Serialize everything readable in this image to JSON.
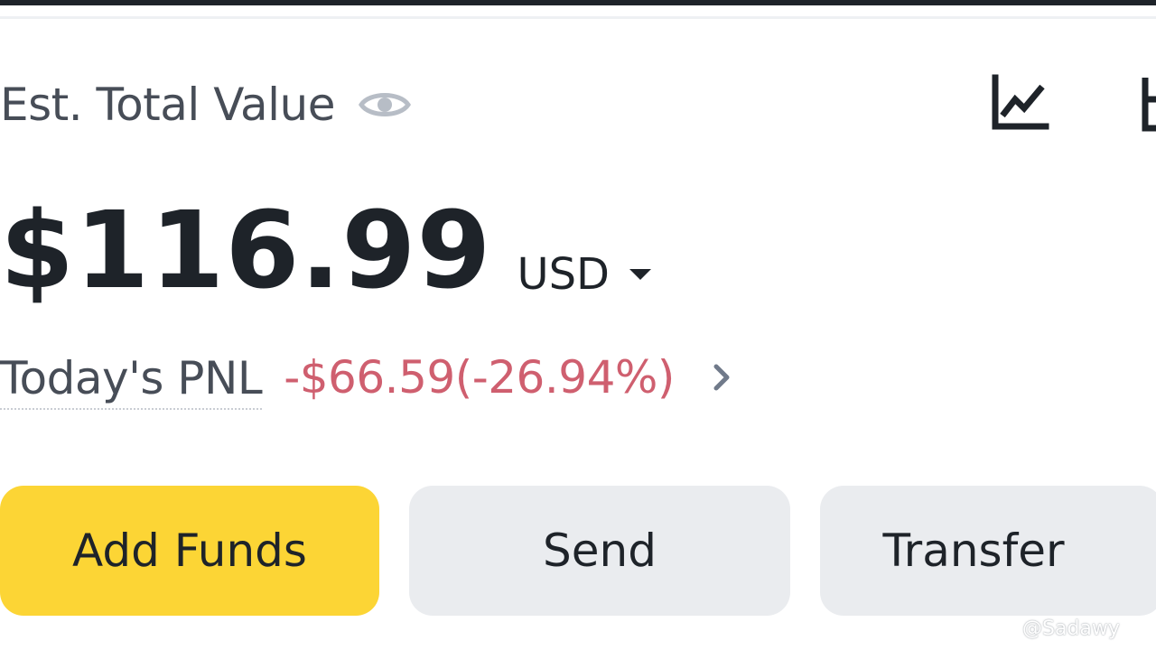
{
  "header": {
    "est_label": "Est. Total Value"
  },
  "balance": {
    "amount": "$116.99",
    "currency": "USD"
  },
  "pnl": {
    "label": "Today's PNL",
    "value": "-$66.59(-26.94%)",
    "color": "#cf5f6f"
  },
  "actions": {
    "add_funds": "Add Funds",
    "send": "Send",
    "transfer": "Transfer"
  },
  "colors": {
    "primary_button": "#fcd535",
    "secondary_button": "#eaecef",
    "text": "#1e2329"
  },
  "icons": {
    "visibility": "eye-icon",
    "chart": "line-chart-icon",
    "more": "partial-icon",
    "currency_menu": "caret-down-icon",
    "pnl_detail": "chevron-right-icon"
  },
  "watermark": {
    "text": "@Sadawy"
  }
}
